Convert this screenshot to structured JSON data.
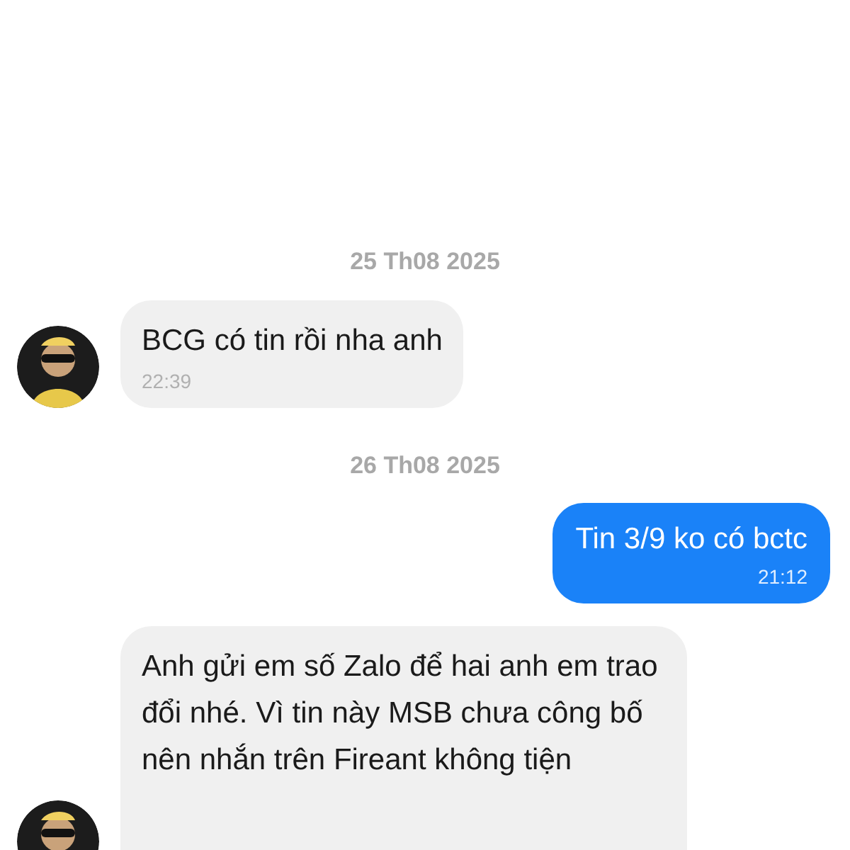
{
  "messages": [
    {
      "kind": "date",
      "text": "25 Th08 2025"
    },
    {
      "kind": "incoming",
      "text": "BCG có tin rồi nha anh",
      "time": "22:39"
    },
    {
      "kind": "date",
      "text": "26 Th08 2025"
    },
    {
      "kind": "outgoing",
      "text": "Tin 3/9 ko có bctc",
      "time": "21:12"
    },
    {
      "kind": "incoming",
      "text": "Anh gửi em số Zalo để hai anh em trao đổi nhé. Vì tin này MSB chưa công bố nên nhắn trên Fireant không tiện"
    }
  ]
}
